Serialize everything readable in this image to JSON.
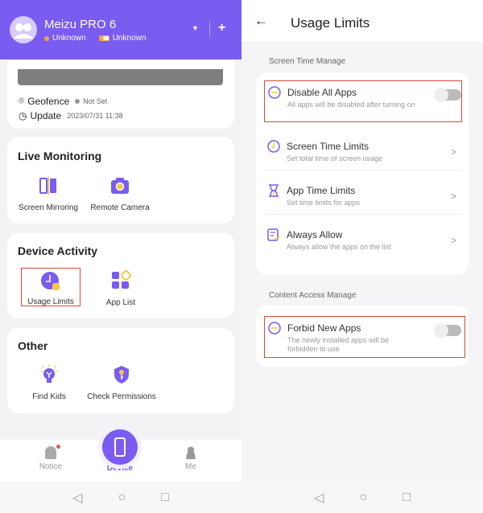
{
  "left": {
    "header": {
      "device_name": "Meizu PRO 6",
      "status": "Unknown",
      "battery": "Unknown",
      "status_color": "#f5a04a"
    },
    "location": {
      "geofence_label": "Geofence",
      "geofence_value": "Not Set",
      "update_label": "Update",
      "update_value": "2023/07/31 11:38"
    },
    "live_monitoring": {
      "title": "Live Monitoring",
      "items": [
        {
          "label": "Screen Mirroring"
        },
        {
          "label": "Remote Camera"
        }
      ]
    },
    "device_activity": {
      "title": "Device Activity",
      "items": [
        {
          "label": "Usage Limits",
          "highlighted": true
        },
        {
          "label": "App List"
        }
      ]
    },
    "other": {
      "title": "Other",
      "items": [
        {
          "label": "Find Kids"
        },
        {
          "label": "Check Permissions"
        }
      ]
    },
    "bottom_nav": [
      {
        "label": "Notice",
        "badge": true
      },
      {
        "label": "Device",
        "active": true
      },
      {
        "label": "Me"
      }
    ]
  },
  "right": {
    "title": "Usage Limits",
    "screen_time": {
      "label": "Screen Time Manage",
      "rows": [
        {
          "title": "Disable All Apps",
          "subtitle": "All apps will be disabled after turning on",
          "toggle": false
        },
        {
          "title": "Screen Time Limits",
          "subtitle": "Set total time of screen usage"
        },
        {
          "title": "App Time Limits",
          "subtitle": "Set time limits for apps"
        },
        {
          "title": "Always Allow",
          "subtitle": "Always allow the apps on the list"
        }
      ]
    },
    "content_access": {
      "label": "Content Access Manage",
      "rows": [
        {
          "title": "Forbid New Apps",
          "subtitle": "The newly installed apps will be forbidden to use",
          "toggle": false
        }
      ]
    }
  },
  "colors": {
    "accent": "#7a5cf0",
    "highlight": "#d9483b",
    "yellow": "#f5c842"
  }
}
